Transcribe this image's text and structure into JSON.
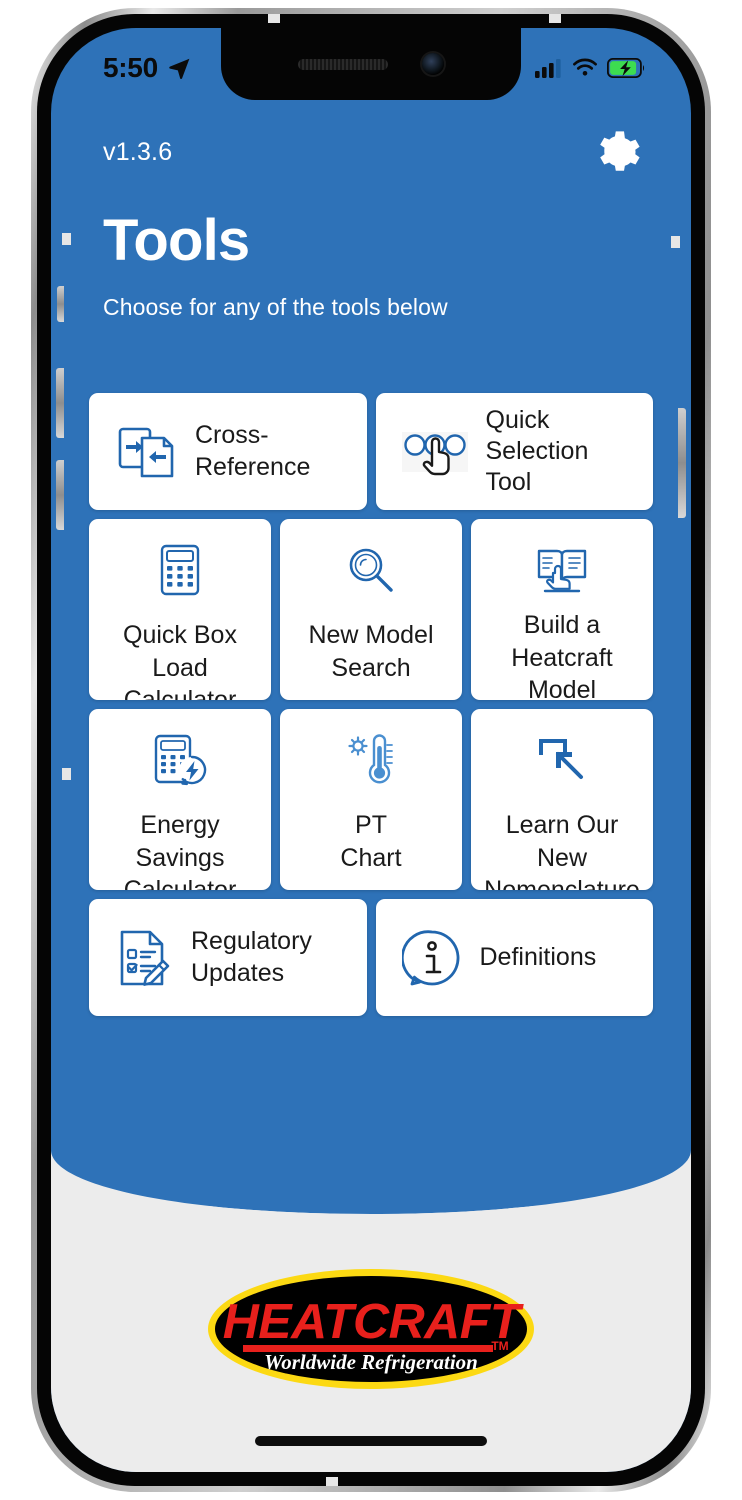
{
  "status_bar": {
    "time": "5:50",
    "location_icon": "location-arrow-icon",
    "cellular_icon": "cellular-signal-icon",
    "wifi_icon": "wifi-icon",
    "battery_icon": "battery-charging-icon",
    "battery_color": "#3ddc50"
  },
  "header": {
    "version": "v1.3.6",
    "settings_icon": "gear-icon",
    "title": "Tools",
    "subtitle": "Choose for any of the tools below"
  },
  "colors": {
    "brand_blue": "#2E72B8",
    "card_white": "#FFFFFF",
    "icon_blue": "#2166AE",
    "footer_gray": "#ECECEC",
    "logo_red": "#E8201C",
    "logo_yellow": "#FCD913",
    "logo_black": "#000000"
  },
  "tools": {
    "rows": [
      {
        "layout": "wide",
        "items": [
          {
            "label": "Cross-\nReference",
            "icon": "cross-reference-icon"
          },
          {
            "label": "Quick\nSelection Tool",
            "icon": "quick-selection-icon"
          }
        ]
      },
      {
        "layout": "square",
        "items": [
          {
            "label": "Quick Box\nLoad Calculator",
            "icon": "calculator-icon"
          },
          {
            "label": "New Model\nSearch",
            "icon": "magnifier-icon"
          },
          {
            "label": "Build a\nHeatcraft\nModel",
            "icon": "book-hand-icon"
          }
        ]
      },
      {
        "layout": "square",
        "items": [
          {
            "label": "Energy Savings\nCalculator",
            "icon": "calculator-bolt-icon"
          },
          {
            "label": "PT\nChart",
            "icon": "thermometer-gear-icon"
          },
          {
            "label": "Learn Our New\nNomenclature",
            "icon": "arrow-corner-icon"
          }
        ]
      },
      {
        "layout": "wide",
        "items": [
          {
            "label": "Regulatory\nUpdates",
            "icon": "checklist-pencil-icon"
          },
          {
            "label": "Definitions",
            "icon": "info-bubble-icon"
          }
        ]
      }
    ]
  },
  "footer": {
    "logo": {
      "brand": "HEATCRAFT",
      "trademark": "TM",
      "tagline": "Worldwide Refrigeration",
      "icon": "heatcraft-logo"
    },
    "home_indicator": "home-indicator"
  }
}
